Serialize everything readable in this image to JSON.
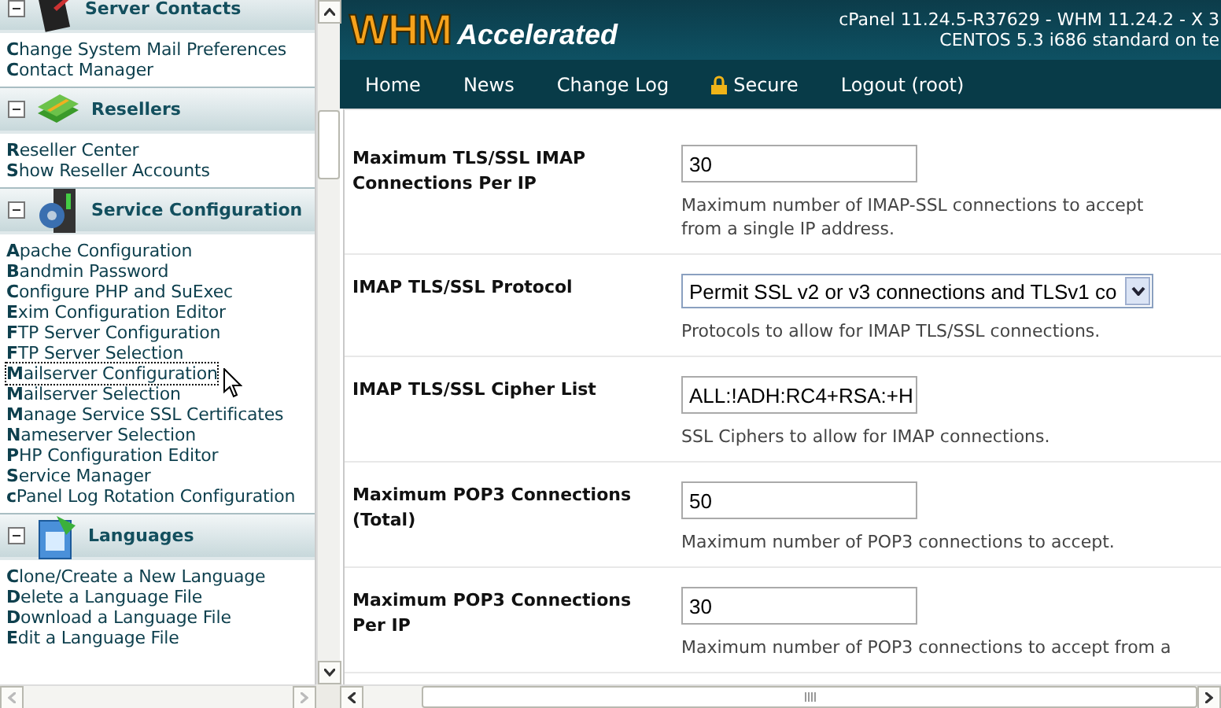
{
  "sidebar": {
    "sections": [
      {
        "title": "Server Contacts",
        "kind": "contacts",
        "expanded": true,
        "items": [
          {
            "label": "**C**hange System Mail Preferences",
            "focused": false
          },
          {
            "label": "**C**ontact Manager",
            "focused": false
          }
        ]
      },
      {
        "title": "Resellers",
        "kind": "resellers",
        "expanded": true,
        "items": [
          {
            "label": "**R**eseller Center",
            "focused": false
          },
          {
            "label": "**S**how Reseller Accounts",
            "focused": false
          }
        ]
      },
      {
        "title": "Service Configuration",
        "kind": "service",
        "expanded": true,
        "items": [
          {
            "label": "**A**pache Configuration",
            "focused": false
          },
          {
            "label": "**B**andmin Password",
            "focused": false
          },
          {
            "label": "**C**onfigure PHP and SuExec",
            "focused": false
          },
          {
            "label": "**E**xim Configuration Editor",
            "focused": false
          },
          {
            "label": "**F**TP Server Configuration",
            "focused": false
          },
          {
            "label": "**F**TP Server Selection",
            "focused": false
          },
          {
            "label": "**M**ailserver Configuration",
            "focused": true
          },
          {
            "label": "**M**ailserver Selection",
            "focused": false
          },
          {
            "label": "**M**anage Service SSL Certificates",
            "focused": false
          },
          {
            "label": "**N**ameserver Selection",
            "focused": false
          },
          {
            "label": "**P**HP Configuration Editor",
            "focused": false
          },
          {
            "label": "**S**ervice Manager",
            "focused": false
          },
          {
            "label": "**c**Panel Log Rotation Configuration",
            "focused": false
          }
        ]
      },
      {
        "title": "Languages",
        "kind": "languages",
        "expanded": true,
        "items": [
          {
            "label": "**C**lone/Create a New Language",
            "focused": false
          },
          {
            "label": "**D**elete a Language File",
            "focused": false
          },
          {
            "label": "**D**ownload a Language File",
            "focused": false
          },
          {
            "label": "**E**dit a Language File",
            "focused": false
          }
        ]
      }
    ]
  },
  "header": {
    "logo_main": "WHM",
    "logo_sub": "Accelerated",
    "version_lines": [
      "cPanel 11.24.5-R37629 - WHM 11.24.2 - X 3",
      "CENTOS 5.3 i686 standard on te"
    ]
  },
  "nav": [
    {
      "label": "Home",
      "kind": "link"
    },
    {
      "label": "News",
      "kind": "link"
    },
    {
      "label": "Change Log",
      "kind": "link"
    },
    {
      "label": "Secure",
      "kind": "secure"
    },
    {
      "label": "Logout (root)",
      "kind": "link"
    }
  ],
  "settings": [
    {
      "label": "Maximum TLS/SSL IMAP Connections Per IP",
      "control": {
        "kind": "text",
        "value": "30"
      },
      "description": "Maximum number of IMAP-SSL connections to accept from a single IP address."
    },
    {
      "label": "IMAP TLS/SSL Protocol",
      "control": {
        "kind": "select",
        "value": "Permit SSL v2 or v3 connections and TLSv1 co"
      },
      "description": "Protocols to allow for IMAP TLS/SSL connections."
    },
    {
      "label": "IMAP TLS/SSL Cipher List",
      "control": {
        "kind": "text",
        "value": "ALL:!ADH:RC4+RSA:+H"
      },
      "description": "SSL Ciphers to allow for IMAP connections."
    },
    {
      "label": "Maximum POP3 Connections (Total)",
      "control": {
        "kind": "text",
        "value": "50"
      },
      "description": "Maximum number of POP3 connections to accept."
    },
    {
      "label": "Maximum POP3 Connections Per IP",
      "control": {
        "kind": "text",
        "value": "30"
      },
      "description": "Maximum number of POP3 connections to accept from a"
    }
  ]
}
